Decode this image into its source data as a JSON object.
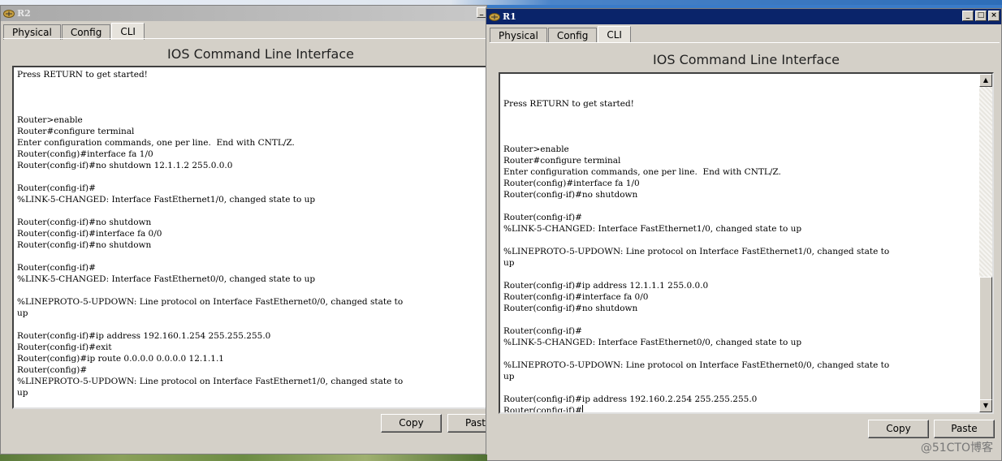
{
  "r2": {
    "title": "R2",
    "tabs": [
      "Physical",
      "Config",
      "CLI"
    ],
    "heading": "IOS Command Line Interface",
    "terminal_text": "Press RETURN to get started!\n\n\n\nRouter>enable\nRouter#configure terminal\nEnter configuration commands, one per line.  End with CNTL/Z.\nRouter(config)#interface fa 1/0\nRouter(config-if)#no shutdown 12.1.1.2 255.0.0.0\n\nRouter(config-if)#\n%LINK-5-CHANGED: Interface FastEthernet1/0, changed state to up\n\nRouter(config-if)#no shutdown\nRouter(config-if)#interface fa 0/0\nRouter(config-if)#no shutdown\n\nRouter(config-if)#\n%LINK-5-CHANGED: Interface FastEthernet0/0, changed state to up\n\n%LINEPROTO-5-UPDOWN: Line protocol on Interface FastEthernet0/0, changed state to\nup\n\nRouter(config-if)#ip address 192.160.1.254 255.255.255.0\nRouter(config-if)#exit\nRouter(config)#ip route 0.0.0.0 0.0.0.0 12.1.1.1\nRouter(config)#\n%LINEPROTO-5-UPDOWN: Line protocol on Interface FastEthernet1/0, changed state to\nup",
    "copy_label": "Copy",
    "paste_label": "Past"
  },
  "r1": {
    "title": "R1",
    "tabs": [
      "Physical",
      "Config",
      "CLI"
    ],
    "heading": "IOS Command Line Interface",
    "terminal_text": "\n\nPress RETURN to get started!\n\n\n\nRouter>enable\nRouter#configure terminal\nEnter configuration commands, one per line.  End with CNTL/Z.\nRouter(config)#interface fa 1/0\nRouter(config-if)#no shutdown\n\nRouter(config-if)#\n%LINK-5-CHANGED: Interface FastEthernet1/0, changed state to up\n\n%LINEPROTO-5-UPDOWN: Line protocol on Interface FastEthernet1/0, changed state to\nup\n\nRouter(config-if)#ip address 12.1.1.1 255.0.0.0\nRouter(config-if)#interface fa 0/0\nRouter(config-if)#no shutdown\n\nRouter(config-if)#\n%LINK-5-CHANGED: Interface FastEthernet0/0, changed state to up\n\n%LINEPROTO-5-UPDOWN: Line protocol on Interface FastEthernet0/0, changed state to\nup\n\nRouter(config-if)#ip address 192.160.2.254 255.255.255.0\nRouter(config-if)#",
    "copy_label": "Copy",
    "paste_label": "Paste",
    "window_buttons": [
      "_",
      "□",
      "×"
    ]
  },
  "watermark": "@51CTO博客",
  "colors": {
    "active_title": "#0a246a",
    "inactive_title": "#a9a9a9",
    "window_face": "#d4d0c8"
  }
}
